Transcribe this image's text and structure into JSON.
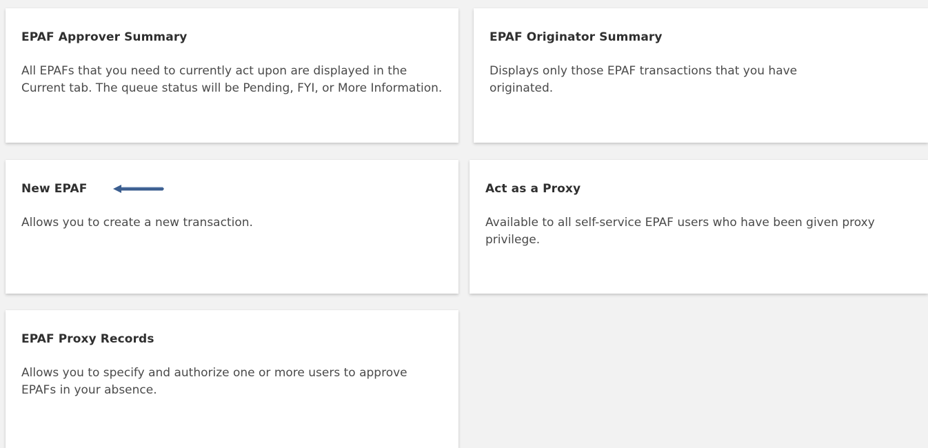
{
  "cards": [
    {
      "title": "EPAF Approver Summary",
      "description": "All EPAFs that you need to currently act upon are displayed in the Current tab. The queue status will be Pending, FYI, or More Information."
    },
    {
      "title": "EPAF Originator Summary",
      "description": "Displays only those EPAF transactions that you have originated."
    },
    {
      "title": "New EPAF",
      "description": "Allows you to create a new transaction."
    },
    {
      "title": "Act as a Proxy",
      "description": "Available to all self-service EPAF users who have been given proxy privilege."
    },
    {
      "title": "EPAF Proxy Records",
      "description": "Allows you to specify and authorize one or more users to approve EPAFs in your absence."
    }
  ],
  "colors": {
    "background": "#f2f2f2",
    "card": "#ffffff",
    "title": "#2f2f2f",
    "text": "#4a4a4a",
    "arrow": "#3b5e8f"
  },
  "icons": {
    "annotation_arrow": "left-arrow-icon"
  }
}
